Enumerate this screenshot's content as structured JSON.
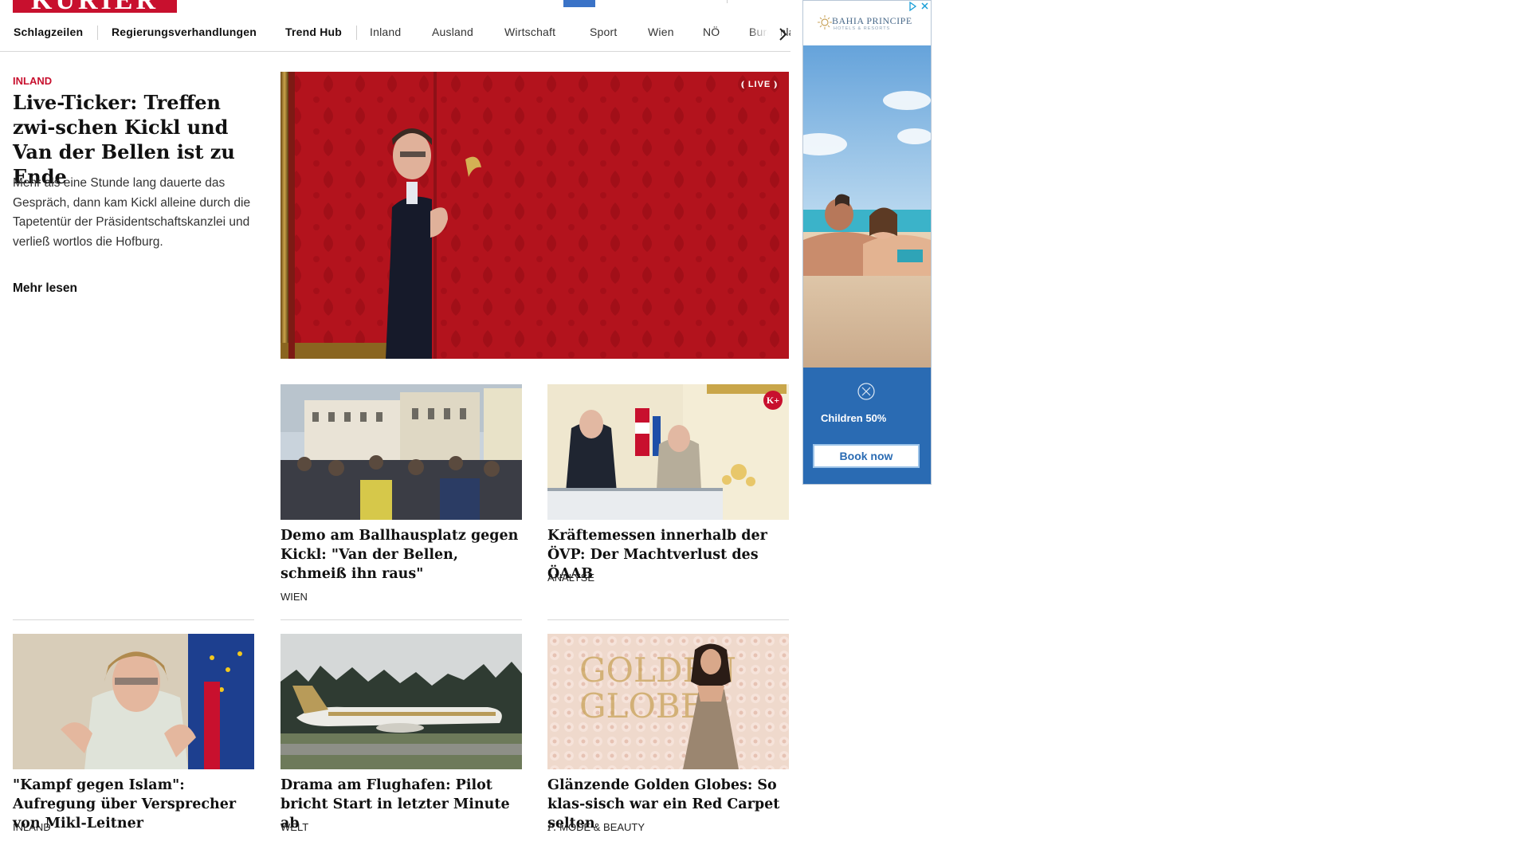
{
  "header": {
    "logo_text": "KURIER"
  },
  "nav": {
    "items": [
      {
        "label": "Schlagzeilen"
      },
      {
        "label": "Regierungsverhandlungen"
      },
      {
        "label": "Trend Hub"
      },
      {
        "label": "Inland"
      },
      {
        "label": "Ausland"
      },
      {
        "label": "Wirtschaft"
      },
      {
        "label": "Sport"
      },
      {
        "label": "Wien"
      },
      {
        "label": "NÖ"
      },
      {
        "label": "Burgenland"
      }
    ],
    "next_icon": "chevron-right-icon"
  },
  "lead": {
    "kicker": "INLAND",
    "title": "Live-Ticker: Treffen zwi-schen Kickl und Van der Bellen ist zu Ende",
    "teaser": "Mehr als eine Stunde lang dauerte das Gespräch, dann kam Kickl alleine durch die Tapetentür der Präsidentschaftskanzlei und verließ wortlos die Hofburg.",
    "more": "Mehr lesen",
    "badge": "LIVE"
  },
  "cards": [
    {
      "title": "Demo am Ballhausplatz gegen Kickl: \"Van der Bellen, schmeiß ihn raus\"",
      "kicker": "WIEN"
    },
    {
      "title": "Kräftemessen innerhalb der ÖVP: Der Machtverlust des ÖAAB",
      "kicker": "ANALYSE",
      "badge": "K+"
    },
    {
      "title": "\"Kampf gegen Islam\": Aufregung über Versprecher von Mikl-Leitner",
      "kicker": "INLAND"
    },
    {
      "title": "Drama am Flughafen: Pilot bricht Start in letzter Minute ab",
      "kicker": "WELT"
    },
    {
      "title": "Glänzende Golden Globes: So klas-sisch war ein Red Carpet selten",
      "kicker": "MODE & BEAUTY"
    }
  ],
  "ad": {
    "brand": "BAHIA PRINCIPE",
    "brand_sub": "HOTELS & RESORTS",
    "promo": "Children 50%",
    "cta": "Book now"
  },
  "colors": {
    "brand_red": "#c8102e",
    "ad_blue": "#2a6bb3"
  }
}
